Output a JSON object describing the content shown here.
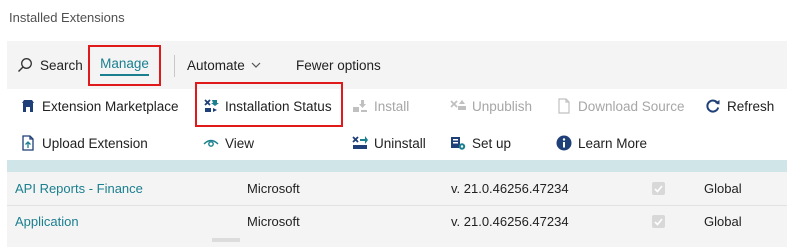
{
  "page": {
    "title": "Installed Extensions"
  },
  "commandbar": {
    "search": "Search",
    "manage": "Manage",
    "automate": "Automate",
    "fewer": "Fewer options"
  },
  "menu": {
    "extension_marketplace": "Extension Marketplace",
    "installation_status": "Installation Status",
    "install": "Install",
    "unpublish": "Unpublish",
    "download_source": "Download Source",
    "refresh": "Refresh",
    "upload_extension": "Upload Extension",
    "view": "View",
    "uninstall": "Uninstall",
    "set_up": "Set up",
    "learn_more": "Learn More"
  },
  "rows": [
    {
      "name": "API Reports - Finance",
      "publisher": "Microsoft",
      "version": "v. 21.0.46256.47234",
      "installed": true,
      "scope": "Global"
    },
    {
      "name": "Application",
      "publisher": "Microsoft",
      "version": "v. 21.0.46256.47234",
      "installed": true,
      "scope": "Global"
    }
  ],
  "colors": {
    "accent": "#1a7f8f",
    "highlight": "#e0191a",
    "disabled": "#a6a6a6"
  }
}
